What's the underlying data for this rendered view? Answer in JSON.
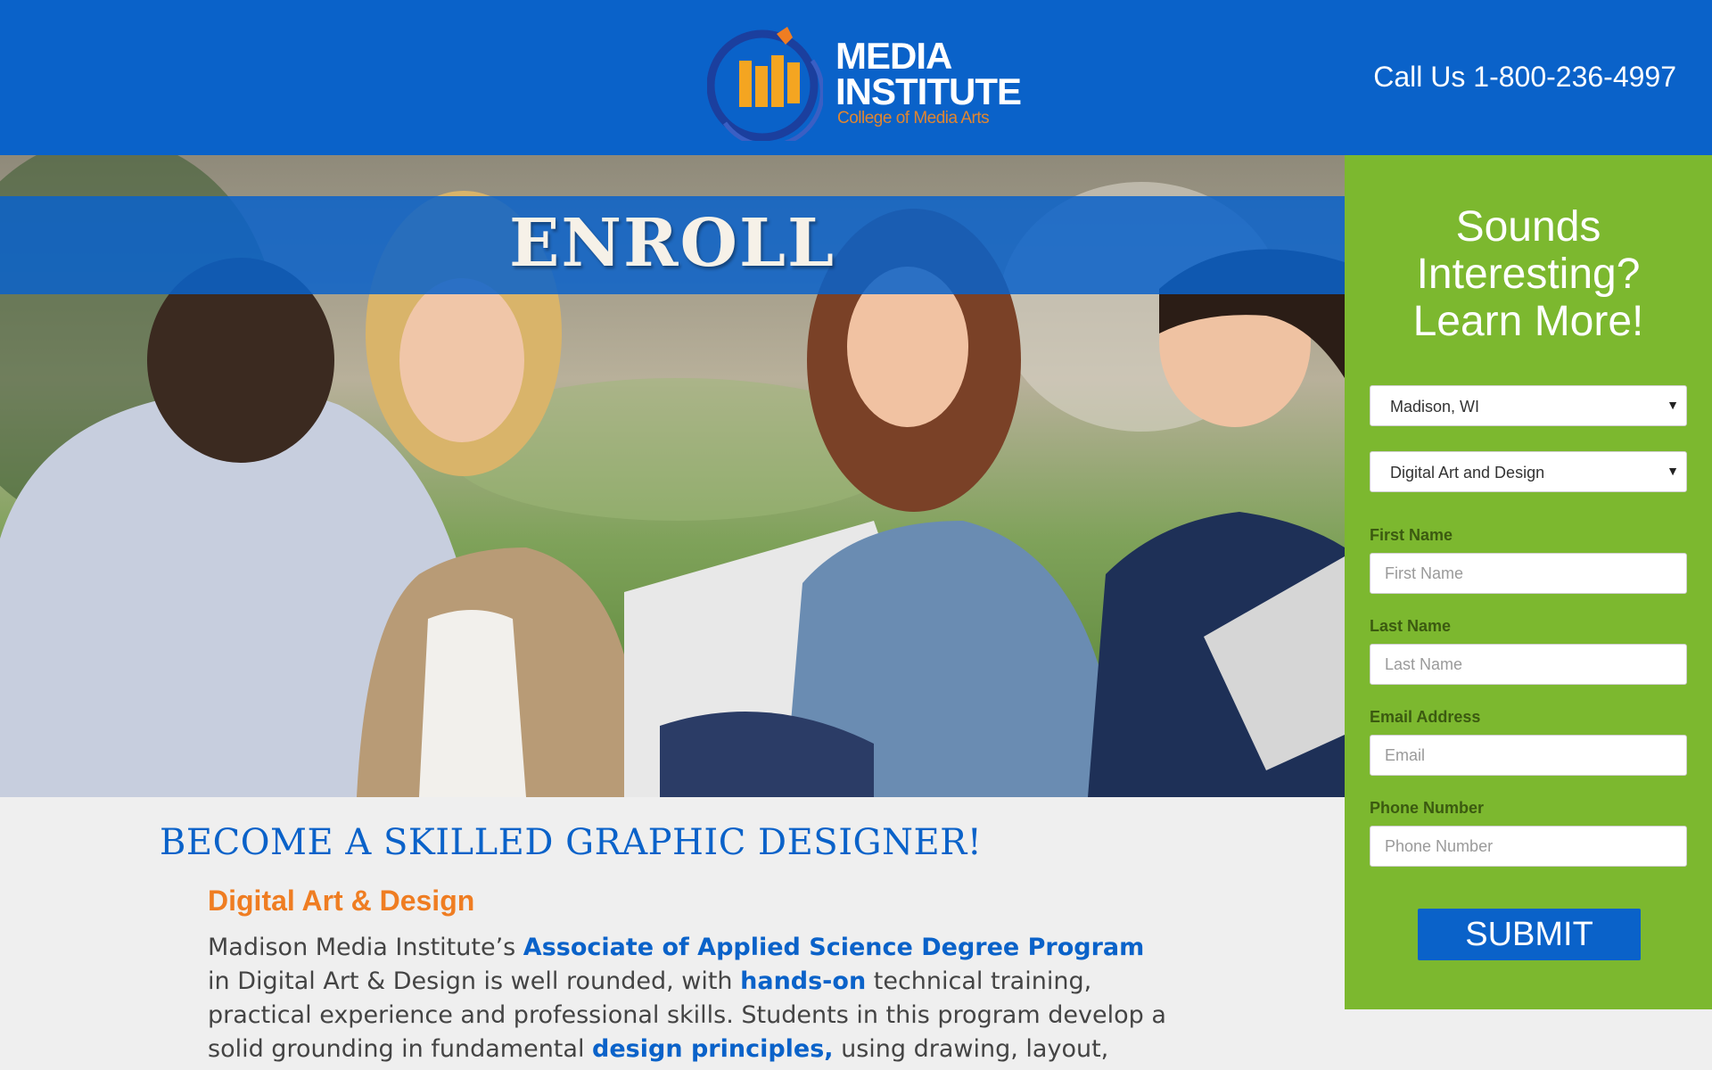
{
  "header": {
    "logo_line1": "MEDIA",
    "logo_line2": "INSTITUTE",
    "logo_subtitle": "College of Media Arts",
    "phone": "Call Us 1-800-236-4997"
  },
  "hero": {
    "banner_text": "ENROLL"
  },
  "main": {
    "headline": "BECOME A SKILLED GRAPHIC DESIGNER!",
    "subheadline": "Digital Art & Design",
    "paragraph": {
      "t1": "Madison Media Institute’s ",
      "h1": "Associate of Applied Science Degree Program",
      "t2": " in Digital Art & Design is well rounded, with ",
      "h2": "hands-on",
      "t3": " technical training, practical experience and professional skills. Students in this program develop a solid grounding in fundamental ",
      "h3": "design principles,",
      "t4": " using drawing, layout, color, typography, and"
    }
  },
  "form": {
    "title_line1": "Sounds",
    "title_line2": "Interesting?",
    "title_line3": "Learn More!",
    "campus_selected": "Madison, WI",
    "program_selected": "Digital Art and Design",
    "first_name_label": "First Name",
    "first_name_placeholder": "First Name",
    "last_name_label": "Last Name",
    "last_name_placeholder": "Last Name",
    "email_label": "Email Address",
    "email_placeholder": "Email",
    "phone_label": "Phone Number",
    "phone_placeholder": "Phone Number",
    "submit_label": "SUBMIT"
  },
  "colors": {
    "brand_blue": "#0a62c9",
    "form_green": "#7cb82f",
    "accent_orange": "#ef7d22"
  }
}
